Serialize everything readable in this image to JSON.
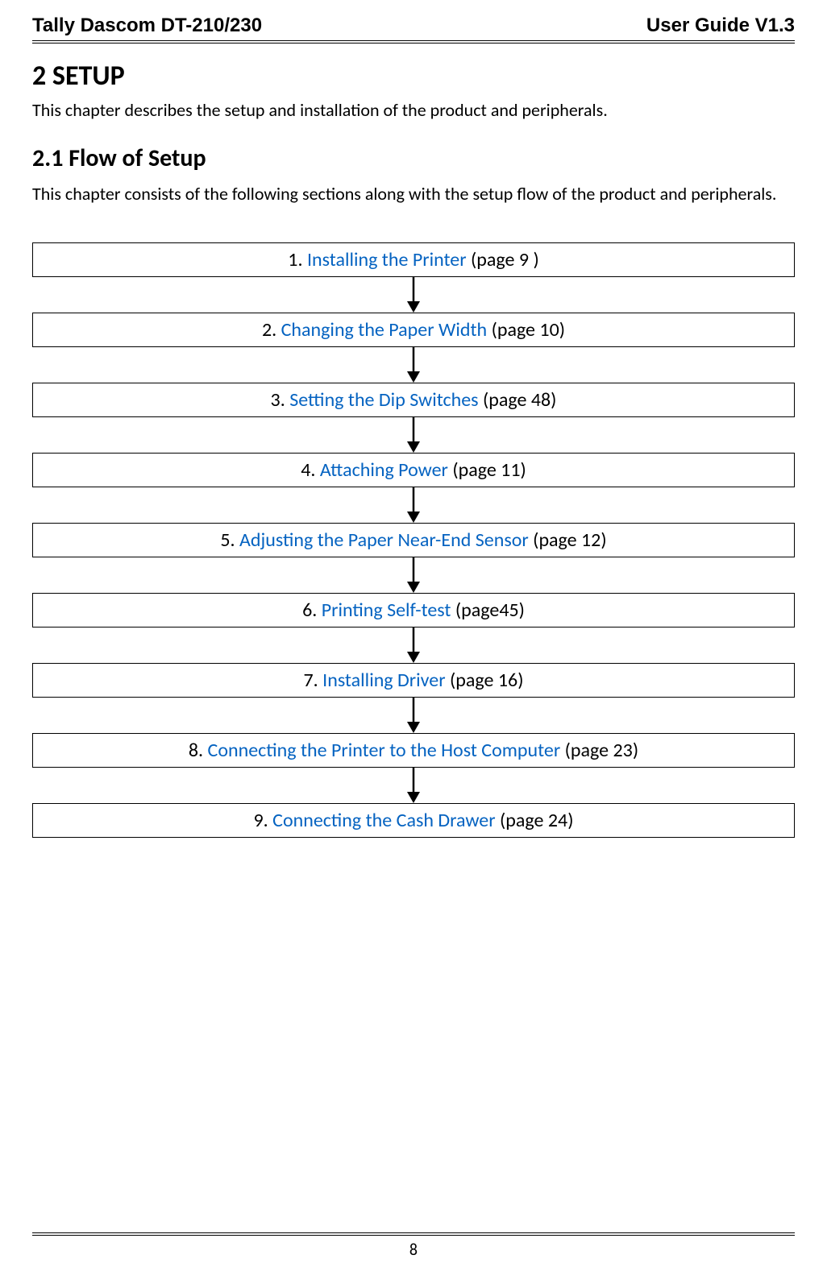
{
  "header": {
    "left": "Tally Dascom DT-210/230",
    "right": "User Guide V1.3"
  },
  "chapter": {
    "title": "2 SETUP",
    "description": "This chapter describes the setup and installation of the product and peripherals."
  },
  "section": {
    "title": "2.1 Flow of Setup",
    "description": "This chapter consists of the following sections along with the setup flow of the product and peripherals."
  },
  "flow_steps": [
    {
      "num": "1. ",
      "link": "Installing the Printer",
      "page": " (page 9 )"
    },
    {
      "num": "2. ",
      "link": "Changing the Paper Width",
      "page": " (page 10)"
    },
    {
      "num": "3. ",
      "link": "Setting the Dip Switches",
      "page": " (page 48)"
    },
    {
      "num": "4. ",
      "link": "Attaching Power",
      "page": " (page 11)"
    },
    {
      "num": "5. ",
      "link": "Adjusting the Paper Near-End Sensor",
      "page": " (page 12)"
    },
    {
      "num": "6. ",
      "link": "Printing Self-test",
      "page": " (page45)"
    },
    {
      "num": "7. ",
      "link": "Installing Driver",
      "page": " (page 16)"
    },
    {
      "num": "8. ",
      "link": "Connecting the Printer to the Host Computer",
      "page": " (page 23)"
    },
    {
      "num": "9. ",
      "link": "Connecting the Cash Drawer",
      "page": " (page 24)"
    }
  ],
  "footer": {
    "page_number": "8"
  }
}
